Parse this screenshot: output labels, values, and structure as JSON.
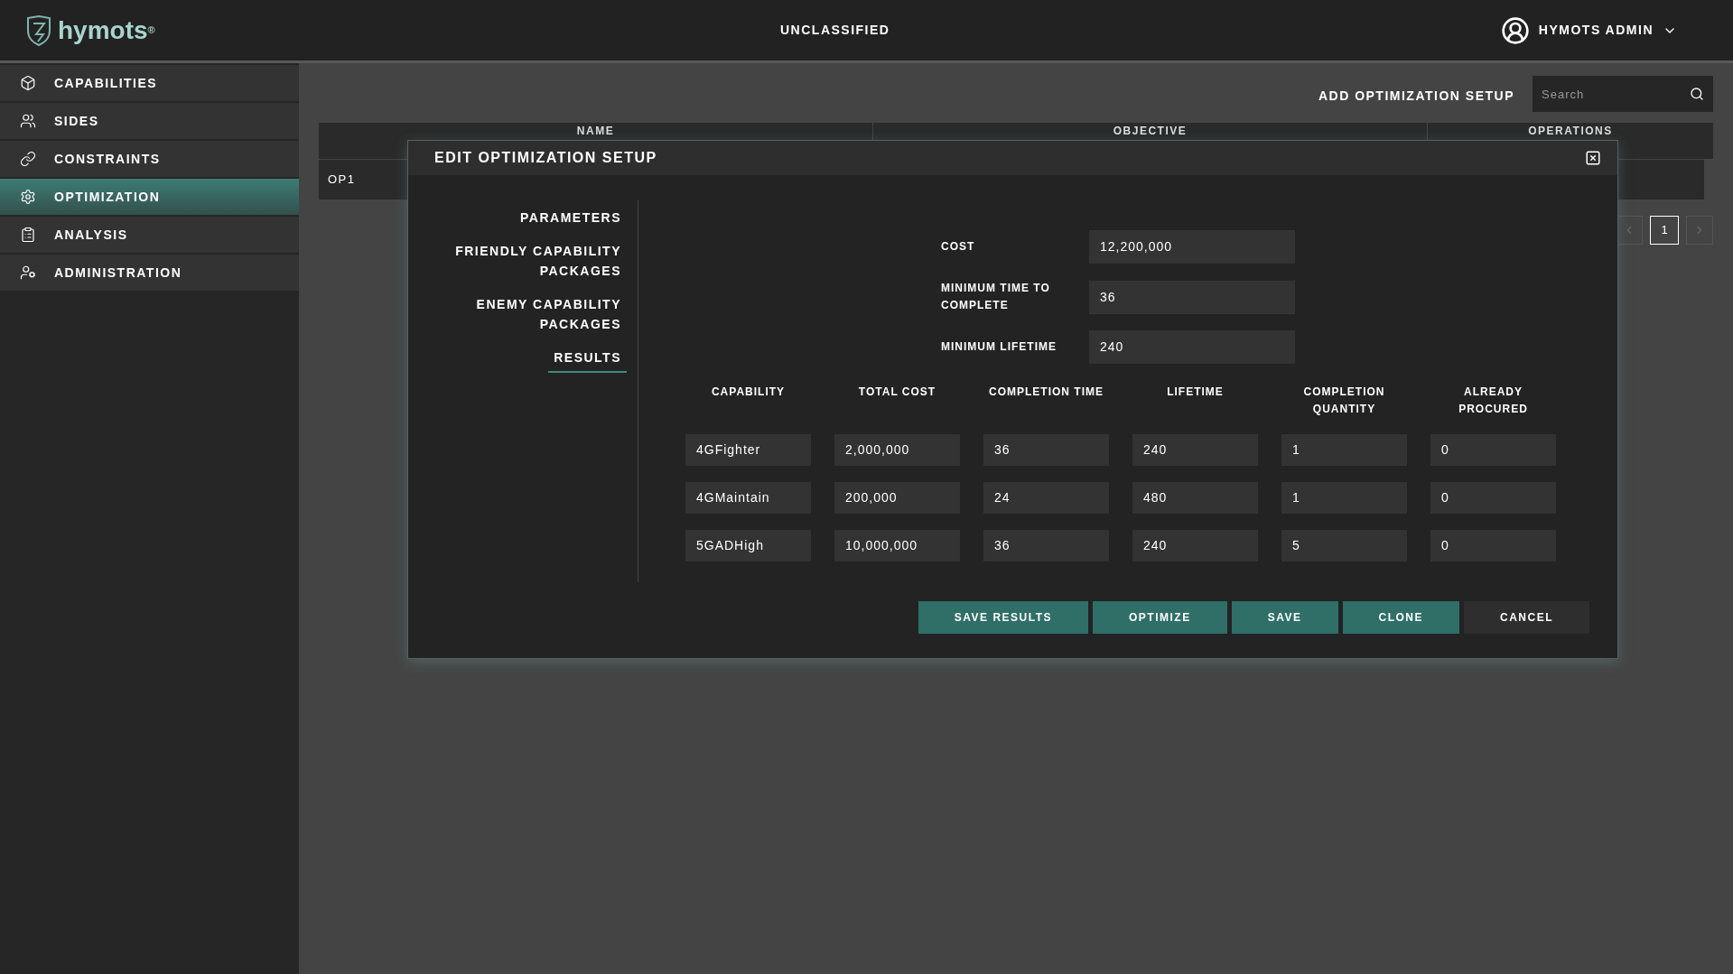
{
  "header": {
    "logo": "hymots",
    "logo_mark": "®",
    "classification": "UNCLASSIFIED",
    "user": "HYMOTS ADMIN"
  },
  "sidebar": {
    "items": [
      {
        "label": "CAPABILITIES",
        "selected": false
      },
      {
        "label": "SIDES",
        "selected": false
      },
      {
        "label": "CONSTRAINTS",
        "selected": false
      },
      {
        "label": "OPTIMIZATION",
        "selected": true
      },
      {
        "label": "ANALYSIS",
        "selected": false
      },
      {
        "label": "ADMINISTRATION",
        "selected": false
      }
    ]
  },
  "toolbar": {
    "add_button": "ADD OPTIMIZATION SETUP",
    "search": {
      "placeholder": "Search"
    }
  },
  "table": {
    "columns": [
      "NAME",
      "OBJECTIVE",
      "OPERATIONS"
    ],
    "rows": [
      {
        "name": "OP1"
      }
    ]
  },
  "pagination": {
    "pages": [
      {
        "label": "1",
        "selected": true
      }
    ]
  },
  "dialog": {
    "title": "EDIT OPTIMIZATION SETUP",
    "nav": [
      {
        "label": "PARAMETERS",
        "selected": false
      },
      {
        "label": "FRIENDLY CAPABILITY PACKAGES",
        "selected": false
      },
      {
        "label": "ENEMY CAPABILITY PACKAGES",
        "selected": false
      },
      {
        "label": "RESULTS",
        "selected": true
      }
    ],
    "parameters": [
      {
        "label": "COST",
        "value": "12,200,000"
      },
      {
        "label": "MINIMUM TIME TO COMPLETE",
        "value": "36"
      },
      {
        "label": "MINIMUM LIFETIME",
        "value": "240"
      }
    ],
    "results": {
      "columns": [
        "CAPABILITY",
        "TOTAL COST",
        "COMPLETION TIME",
        "LIFETIME",
        "COMPLETION QUANTITY",
        "ALREADY PROCURED"
      ],
      "rows": [
        [
          "4GFighter",
          "2,000,000",
          "36",
          "240",
          "1",
          "0"
        ],
        [
          "4GMaintain",
          "200,000",
          "24",
          "480",
          "1",
          "0"
        ],
        [
          "5GADHigh",
          "10,000,000",
          "36",
          "240",
          "5",
          "0"
        ]
      ]
    },
    "buttons": [
      {
        "label": "SAVE RESULTS",
        "kind": "primary"
      },
      {
        "label": "OPTIMIZE",
        "kind": "primary"
      },
      {
        "label": "SAVE",
        "kind": "primary"
      },
      {
        "label": "CLONE",
        "kind": "primary"
      },
      {
        "label": "CANCEL",
        "kind": "secondary"
      }
    ]
  }
}
